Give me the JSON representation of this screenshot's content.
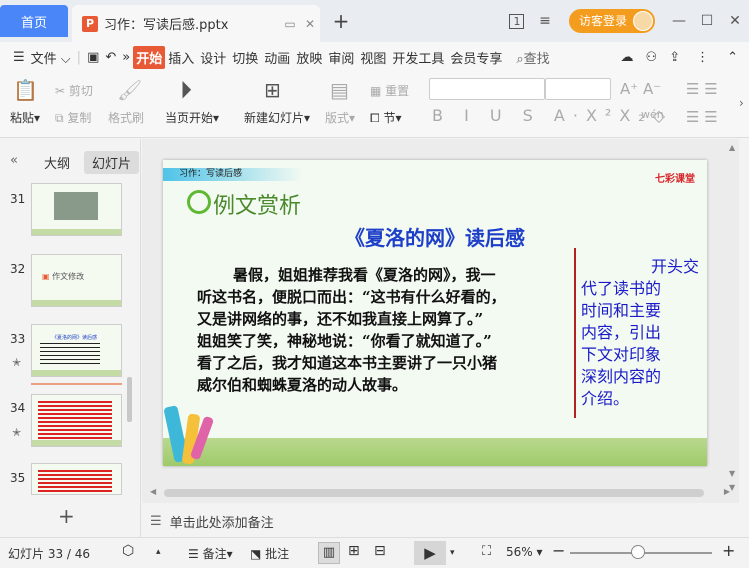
{
  "titlebar": {
    "home_tab": "首页",
    "doc_tab_title": "习作：写读后感.pptx",
    "doc_icon": "P",
    "login_label": "访客登录",
    "page_badge": "1"
  },
  "menubar": {
    "file": "文件",
    "tabs": [
      "开始",
      "插入",
      "设计",
      "切换",
      "动画",
      "放映",
      "审阅",
      "视图",
      "开发工具",
      "会员专享"
    ],
    "search": "查找"
  },
  "toolbar": {
    "paste": "粘贴",
    "cut": "剪切",
    "copy": "复制",
    "format_painter": "格式刷",
    "start_from_current": "当页开始",
    "new_slide": "新建幻灯片",
    "layout": "版式",
    "reset": "重置",
    "section": "节"
  },
  "leftpanel": {
    "tab_outline": "大纲",
    "tab_slides": "幻灯片",
    "thumbs": [
      {
        "num": "31"
      },
      {
        "num": "32",
        "label": "作文修改"
      },
      {
        "num": "33",
        "label": "《夏洛的网》读后感"
      },
      {
        "num": "34"
      },
      {
        "num": "35"
      }
    ]
  },
  "slide": {
    "header_label": "习作：写读后感",
    "brand": "七彩课堂",
    "section_title": "例文赏析",
    "main_title": "《夏洛的网》读后感",
    "body_lines": [
      "暑假，姐姐推荐我看《夏洛的网》，我一",
      "听这书名，便脱口而出：“这书有什么好看的，",
      "又是讲网络的事，还不如我直接上网算了。”",
      "姐姐笑了笑，神秘地说：“你看了就知道了。”",
      "看了之后，我才知道这本书主要讲了一只小猪",
      "威尔伯和蜘蛛夏洛的动人故事。"
    ],
    "side_note_lines": [
      "开头交",
      "代了读书的",
      "时间和主要",
      "内容，引出",
      "下文对印象",
      "深刻内容的",
      "介绍。"
    ]
  },
  "notes": {
    "placeholder": "单击此处添加备注"
  },
  "statusbar": {
    "slide_counter": "幻灯片 33 / 46",
    "notes": "备注",
    "comments": "批注",
    "zoom": "56%",
    "zoom_level": 0.48
  },
  "colors": {
    "accent": "#e85a35",
    "home_tab": "#4a86f7",
    "login": "#f39c1e",
    "slide_title": "#1d3ec9",
    "side_note": "#1a1ac8"
  }
}
